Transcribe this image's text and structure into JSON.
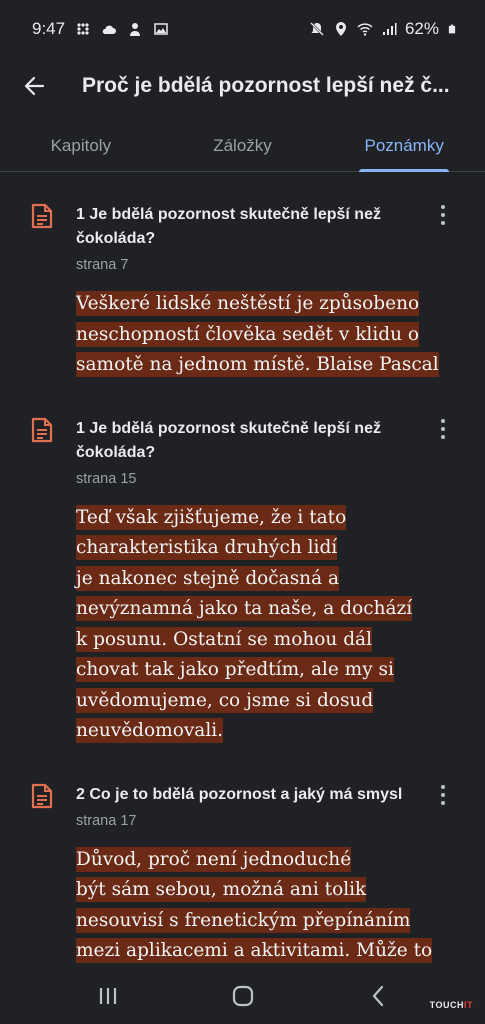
{
  "status_bar": {
    "time": "9:47",
    "battery": "62%",
    "icons_left": [
      "grid-icon",
      "cloud-icon",
      "person-icon",
      "image-icon"
    ],
    "icons_right": [
      "mute-icon",
      "location-icon",
      "wifi-icon",
      "signal-icon",
      "battery-icon"
    ]
  },
  "app_bar": {
    "title": "Proč je bdělá pozornost lepší než č..."
  },
  "tabs": [
    {
      "label": "Kapitoly",
      "active": false
    },
    {
      "label": "Záložky",
      "active": false
    },
    {
      "label": "Poznámky",
      "active": true
    }
  ],
  "notes": [
    {
      "chapter": "1 Je bdělá pozornost skutečně lepší než čokoláda?",
      "page": "strana 7",
      "lines": [
        "Veškeré lidské neštěstí je způsobeno",
        "neschopností člověka sedět v klidu o",
        "samotě na jednom místě. Blaise Pascal"
      ]
    },
    {
      "chapter": "1 Je bdělá pozornost skutečně lepší než čokoláda?",
      "page": "strana 15",
      "lines": [
        "Teď však zjišťujeme, že i tato",
        "charakteristika druhých lidí",
        "je nakonec stejně dočasná a",
        "nevýznamná jako ta naše, a dochází",
        "k posunu. Ostatní se mohou dál",
        "chovat tak jako předtím, ale my si",
        "uvědomujeme, co jsme si dosud",
        "neuvědomovali."
      ]
    },
    {
      "chapter": "2 Co je to bdělá pozornost a jaký má smysl",
      "page": "strana 17",
      "lines": [
        "Důvod, proč není jednoduché",
        "být sám sebou, možná ani tolik",
        "nesouvisí s frenetickým přepínáním",
        "mezi aplikacemi a aktivitami. Může to být"
      ]
    }
  ],
  "watermark": {
    "prefix": "TOUCH",
    "suffix": "IT"
  },
  "colors": {
    "background": "#202124",
    "accent": "#8ab4f8",
    "highlight": "#6b2a16",
    "note_icon": "#e0704f"
  }
}
